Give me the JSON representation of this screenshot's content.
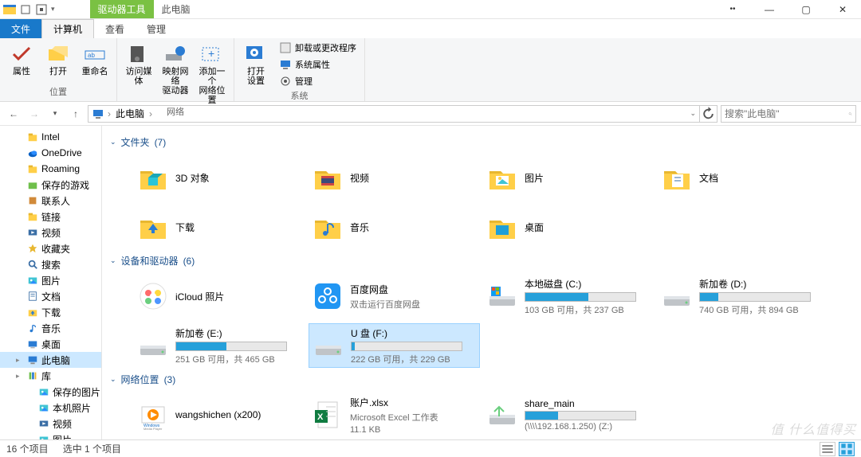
{
  "window": {
    "qat_dropdown": "▾",
    "contextual_tab": "驱动器工具",
    "title": "此电脑",
    "controls": {
      "min": "—",
      "max": "▢",
      "close": "✕",
      "ribbon_min": "⌄",
      "help": "?"
    }
  },
  "ribbon_tabs": {
    "file": "文件",
    "computer": "计算机",
    "view": "查看",
    "manage": "管理"
  },
  "ribbon": {
    "group_location": {
      "label": "位置",
      "properties": "属性",
      "open": "打开",
      "rename": "重命名"
    },
    "group_network": {
      "label": "网络",
      "media": "访问媒体",
      "map_drive": "映射网络\n驱动器",
      "add_loc": "添加一个\n网络位置"
    },
    "group_system": {
      "label": "系统",
      "open_settings": "打开\n设置",
      "uninstall": "卸载或更改程序",
      "sys_props": "系统属性",
      "manage": "管理"
    }
  },
  "nav": {
    "breadcrumb": [
      "此电脑"
    ],
    "refresh_tip": "刷新",
    "search_placeholder": "搜索\"此电脑\""
  },
  "tree": [
    {
      "label": "Intel",
      "icon": "folder"
    },
    {
      "label": "OneDrive",
      "icon": "onedrive"
    },
    {
      "label": "Roaming",
      "icon": "folder"
    },
    {
      "label": "保存的游戏",
      "icon": "folder-green"
    },
    {
      "label": "联系人",
      "icon": "contacts"
    },
    {
      "label": "链接",
      "icon": "folder"
    },
    {
      "label": "视频",
      "icon": "video"
    },
    {
      "label": "收藏夹",
      "icon": "star"
    },
    {
      "label": "搜索",
      "icon": "search"
    },
    {
      "label": "图片",
      "icon": "pictures"
    },
    {
      "label": "文档",
      "icon": "docs"
    },
    {
      "label": "下载",
      "icon": "downloads"
    },
    {
      "label": "音乐",
      "icon": "music"
    },
    {
      "label": "桌面",
      "icon": "desktop"
    },
    {
      "label": "此电脑",
      "icon": "pc",
      "selected": true,
      "expandable": true
    },
    {
      "label": "库",
      "icon": "library",
      "expandable": true
    },
    {
      "label": "保存的图片",
      "icon": "pictures",
      "indent": 1
    },
    {
      "label": "本机照片",
      "icon": "pictures",
      "indent": 1
    },
    {
      "label": "视频",
      "icon": "video",
      "indent": 1
    },
    {
      "label": "图片",
      "icon": "pictures",
      "indent": 1
    }
  ],
  "groups": {
    "folders": {
      "title": "文件夹",
      "count": "(7)"
    },
    "devices": {
      "title": "设备和驱动器",
      "count": "(6)"
    },
    "network": {
      "title": "网络位置",
      "count": "(3)"
    }
  },
  "folders": [
    {
      "name": "3D 对象",
      "icon": "3d"
    },
    {
      "name": "视频",
      "icon": "video"
    },
    {
      "name": "图片",
      "icon": "pictures"
    },
    {
      "name": "文档",
      "icon": "docs"
    },
    {
      "name": "下载",
      "icon": "downloads"
    },
    {
      "name": "音乐",
      "icon": "music"
    },
    {
      "name": "桌面",
      "icon": "desktop"
    }
  ],
  "devices": [
    {
      "name": "iCloud 照片",
      "sub": "",
      "icon": "icloud",
      "bar": null
    },
    {
      "name": "百度网盘",
      "sub": "双击运行百度网盘",
      "icon": "baidu",
      "bar": null
    },
    {
      "name": "本地磁盘 (C:)",
      "sub": "103 GB 可用，共 237 GB",
      "icon": "drive-win",
      "bar": 57
    },
    {
      "name": "新加卷 (D:)",
      "sub": "740 GB 可用，共 894 GB",
      "icon": "drive",
      "bar": 17
    },
    {
      "name": "新加卷 (E:)",
      "sub": "251 GB 可用，共 465 GB",
      "icon": "drive",
      "bar": 46
    },
    {
      "name": "U 盘 (F:)",
      "sub": "222 GB 可用，共 229 GB",
      "icon": "drive",
      "bar": 3,
      "selected": true
    }
  ],
  "network_items": [
    {
      "name": "wangshichen (x200)",
      "sub": "",
      "icon": "wmp"
    },
    {
      "name": "账户.xlsx",
      "sub": "Microsoft Excel 工作表",
      "sub2": "11.1 KB",
      "icon": "xlsx"
    },
    {
      "name": "share_main",
      "sub": "(\\\\\\\\192.168.1.250) (Z:)",
      "icon": "netdrive",
      "bar": 30
    }
  ],
  "status": {
    "total": "16 个项目",
    "selected": "选中 1 个项目"
  },
  "watermark": "值 什么值得买"
}
